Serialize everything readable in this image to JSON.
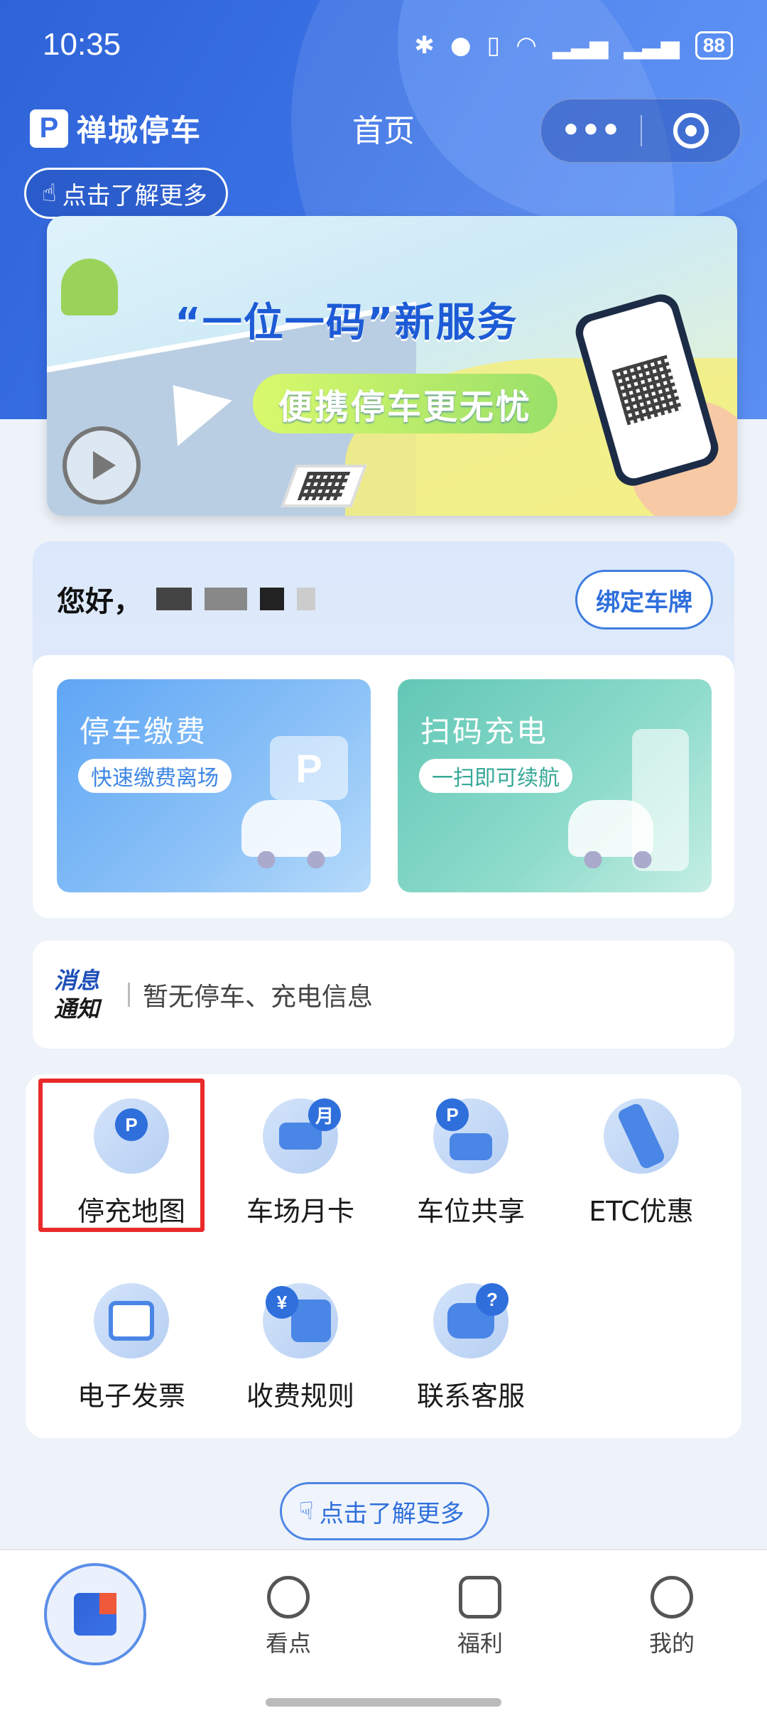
{
  "status_bar": {
    "time": "10:35",
    "icons": [
      "bluetooth-icon",
      "location-icon",
      "vibrate-icon",
      "wifi-icon",
      "signal-icon",
      "signal-icon"
    ],
    "battery": "88"
  },
  "header": {
    "brand_logo": "P",
    "brand_name": "禅城停车",
    "title": "首页",
    "capsule_more": "•••",
    "learn_more": "点击了解更多"
  },
  "banner": {
    "title": "“一位一码”新服务",
    "subtitle": "便携停车更无忧"
  },
  "user": {
    "greeting": "您好，",
    "bind_button": "绑定车牌"
  },
  "services": [
    {
      "title": "停车缴费",
      "subtitle": "快速缴费离场",
      "sign": "P"
    },
    {
      "title": "扫码充电",
      "subtitle": "一扫即可续航"
    }
  ],
  "notice": {
    "tag_line1": "消息",
    "tag_line2": "通知",
    "message": "暂无停车、充电信息"
  },
  "tools": [
    {
      "label": "停充地图",
      "badge": "P",
      "icon": "map-pin-icon"
    },
    {
      "label": "车场月卡",
      "badge": "月",
      "icon": "monthly-card-icon"
    },
    {
      "label": "车位共享",
      "badge": "P",
      "icon": "share-parking-icon"
    },
    {
      "label": "ETC优惠",
      "badge": "",
      "icon": "etc-road-icon"
    },
    {
      "label": "电子发票",
      "badge": "",
      "icon": "invoice-icon"
    },
    {
      "label": "收费规则",
      "badge": "¥",
      "icon": "fee-rules-icon"
    },
    {
      "label": "联系客服",
      "badge": "?",
      "icon": "customer-service-icon"
    }
  ],
  "bottom_link": "点击了解更多",
  "tabbar": {
    "home_icon": "home-logo-icon",
    "items": [
      {
        "label": "看点",
        "icon": "planet-icon"
      },
      {
        "label": "福利",
        "icon": "ticket-icon"
      },
      {
        "label": "我的",
        "icon": "profile-icon"
      }
    ]
  },
  "colors": {
    "primary": "#2f6fdc",
    "highlight_box": "#ea2a2a"
  }
}
